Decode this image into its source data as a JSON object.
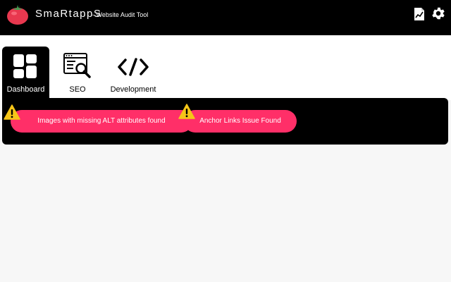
{
  "app": {
    "brand": "SmaRtappS",
    "tagline": "- Website Audit Tool"
  },
  "header": {
    "icons": [
      "tomato-logo-icon",
      "report-chart-icon",
      "gear-icon"
    ]
  },
  "tabs": [
    {
      "label": "Dashboard",
      "icon": "dashboard-grid-icon",
      "active": true
    },
    {
      "label": "SEO",
      "icon": "seo-search-icon",
      "active": false
    },
    {
      "label": "Development",
      "icon": "code-icon",
      "active": false
    }
  ],
  "alerts": [
    {
      "text": "Images with missing ALT attributes found",
      "icon": "warning-icon"
    },
    {
      "text": "Anchor Links Issue Found",
      "icon": "warning-icon"
    }
  ],
  "colors": {
    "header_bg": "#000000",
    "alert_bg": "#ff2f68",
    "warning": "#f5c518",
    "logo_red": "#e8384f",
    "logo_green": "#3aa655"
  }
}
